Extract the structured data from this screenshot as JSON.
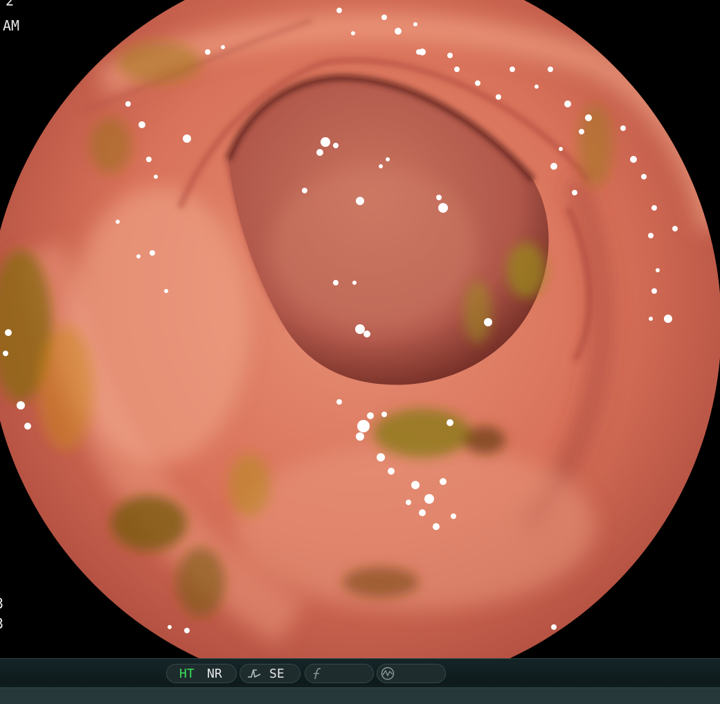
{
  "image": {
    "subject": "endoscopic-bowel-lumen",
    "colors": {
      "mucosa": "#d9725a",
      "deep": "#a9453a",
      "residue": "#8a6a12",
      "bile": "#c98a1c"
    }
  },
  "overlay": {
    "date_fragment": "2",
    "time_fragment": "AM",
    "side_code_1": "3",
    "side_code_2": "3"
  },
  "statusbar": {
    "ht_label": "HT",
    "nr_label": "NR",
    "se_label": "SE",
    "ht_color": "#39e05a",
    "text_color": "#e8e8e8",
    "icons": [
      "curve-icon",
      "function-icon",
      "waveform-icon"
    ]
  }
}
